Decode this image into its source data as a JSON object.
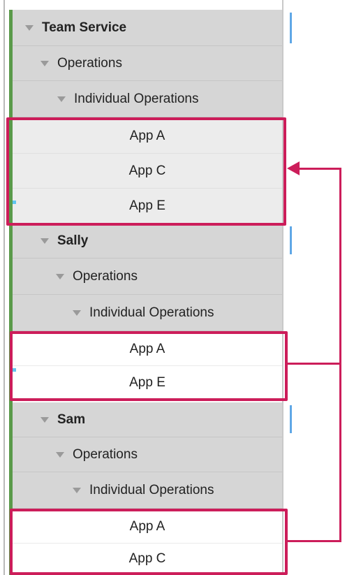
{
  "groups": [
    {
      "name": "Team Service",
      "operations_label": "Operations",
      "individual_label": "Individual Operations",
      "apps": [
        "App A",
        "App C",
        "App E"
      ]
    },
    {
      "name": "Sally",
      "operations_label": "Operations",
      "individual_label": "Individual Operations",
      "apps": [
        "App A",
        "App E"
      ]
    },
    {
      "name": "Sam",
      "operations_label": "Operations",
      "individual_label": "Individual Operations",
      "apps": [
        "App A",
        "App C"
      ]
    }
  ],
  "colors": {
    "highlight": "#cc1d5a",
    "group_bar": "#5a9a4a",
    "header_bg": "#d6d6d6"
  }
}
